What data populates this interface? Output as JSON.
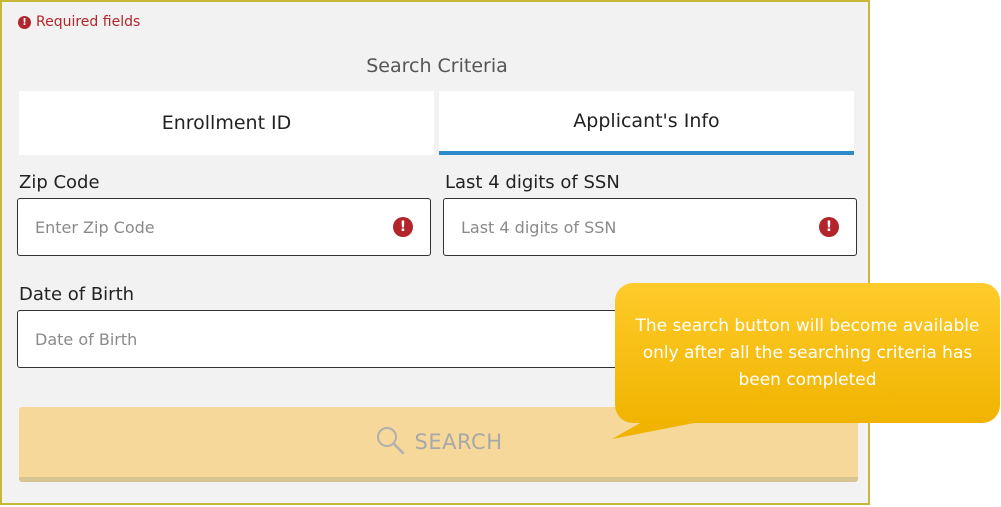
{
  "required_note": "Required fields",
  "search_criteria_title": "Search Criteria",
  "tabs": [
    {
      "label": "Enrollment ID",
      "active": false
    },
    {
      "label": "Applicant's Info",
      "active": true
    }
  ],
  "fields": {
    "zip": {
      "label": "Zip Code",
      "placeholder": "Enter Zip Code"
    },
    "ssn": {
      "label": "Last 4 digits of SSN",
      "placeholder": "Last 4 digits of SSN"
    },
    "dob": {
      "label": "Date of Birth",
      "placeholder": "Date of Birth"
    }
  },
  "search_button": {
    "label": "SEARCH",
    "icon": "search-icon",
    "enabled": false
  },
  "callout": {
    "text": "The search button will become available only after all the searching criteria has been completed"
  },
  "colors": {
    "error": "#b3252b",
    "active_tab": "#2e8bc9",
    "search_disabled": "#f6d99a",
    "callout": "#ffc21a"
  }
}
